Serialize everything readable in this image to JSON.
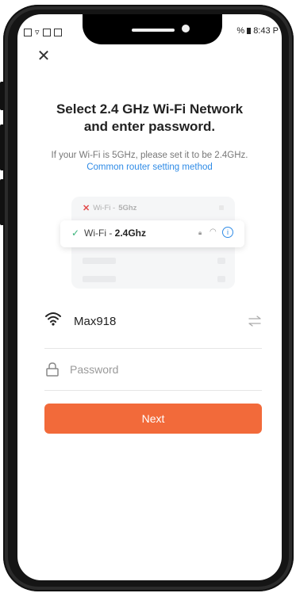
{
  "status_bar": {
    "left_icons": [
      "settings-icon",
      "wifi-icon",
      "image-icon",
      "doc-icon"
    ],
    "battery_text": "%",
    "time": "8:43 P"
  },
  "header": {
    "close_glyph": "✕"
  },
  "content": {
    "title_line1": "Select 2.4 GHz Wi-Fi Network",
    "title_line2": "and enter password.",
    "subtitle": "If your Wi-Fi is 5GHz, please set it to be 2.4GHz.",
    "link": "Common router setting method"
  },
  "illustration": {
    "bad_prefix": "Wi-Fi - ",
    "bad_band": "5Ghz",
    "good_prefix": "Wi-Fi - ",
    "good_band": "2.4Ghz"
  },
  "form": {
    "wifi_name": "Max918",
    "password_placeholder": "Password",
    "password_value": "",
    "next_label": "Next"
  },
  "colors": {
    "accent": "#f26a3a",
    "link": "#2f8be6",
    "check": "#39b37a",
    "cross": "#e24b4b"
  }
}
